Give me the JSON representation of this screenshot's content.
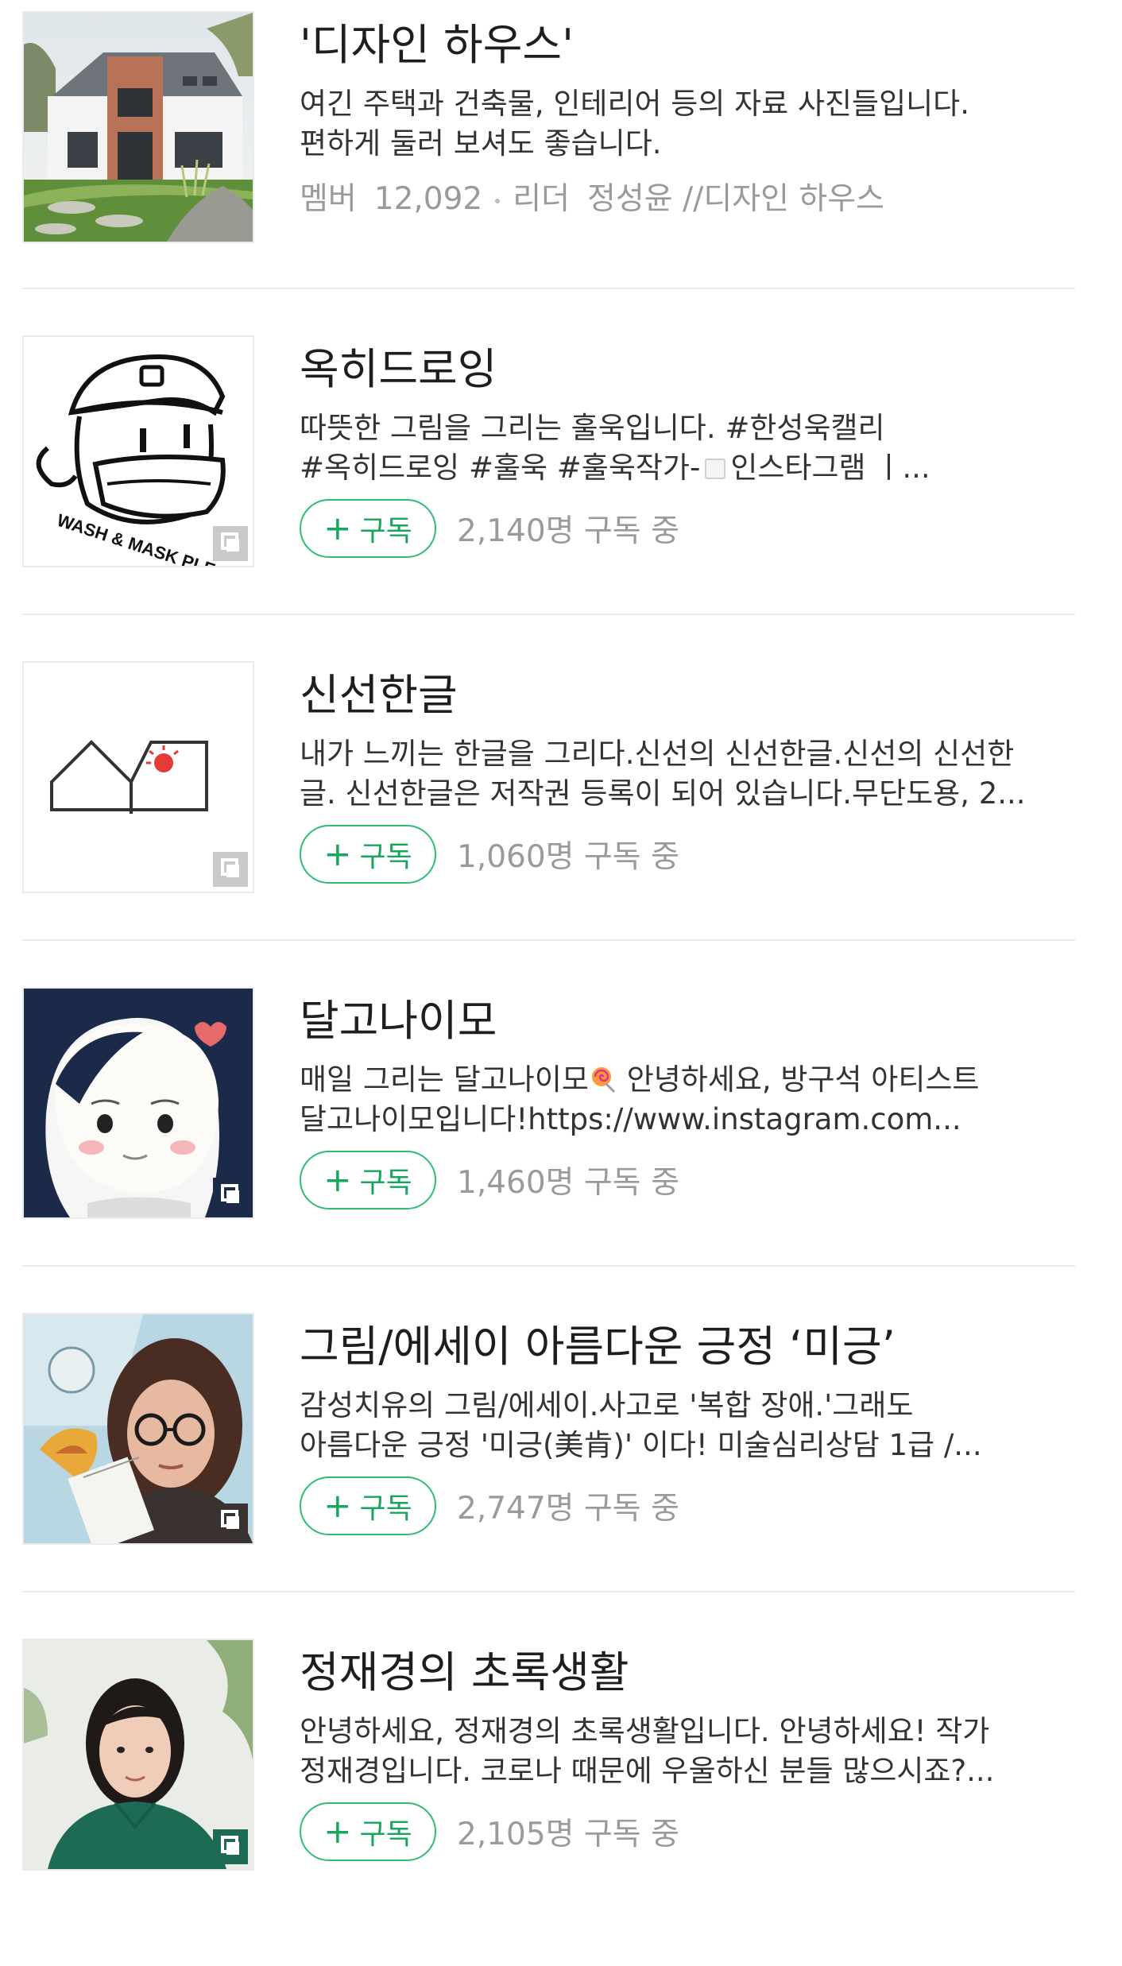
{
  "colors": {
    "accent": "#2ebd72",
    "meta_text": "#9a9a9a",
    "divider": "#ececec"
  },
  "items": [
    {
      "title": "'디자인 하우스'",
      "desc1": "여긴 주택과 건축물, 인테리어 등의 자료 사진들입니다.",
      "desc2": "편하게 둘러 보셔도 좋습니다.",
      "member_label": "멤버",
      "member_count": "12,092",
      "leader_label": "리더",
      "leader_name": "정성윤 //디자인 하우스",
      "thumb_icon": "house-photo"
    },
    {
      "title": "옥히드로잉",
      "desc1": "따뜻한 그림을 그리는 훌욱입니다. #한성욱캘리",
      "desc2a": "#옥히드로잉 #훌욱 #훌욱작가-",
      "desc2b": "인스타그램 ㅣ...",
      "subscribe_label": "구독",
      "subscriber_text": "2,140명 구독 중",
      "thumb_text": "WASH & MASK PLEASE",
      "thumb_icon": "mask-cartoon"
    },
    {
      "title": "신선한글",
      "desc1": "내가 느끼는 한글을 그리다.신선의 신선한글.신선의 신선한",
      "desc2": "글. 신선한글은 저작권 등록이 되어 있습니다.무단도용, 2...",
      "subscribe_label": "구독",
      "subscriber_text": "1,060명 구독 중",
      "thumb_icon": "hangul-roof-sun"
    },
    {
      "title": "달고나이모",
      "desc1a": "매일 그리는 달고나이모",
      "desc1b": " 안녕하세요, 방구석 아티스트",
      "desc2": "달고나이모입니다!https://www.instagram.com...",
      "subscribe_label": "구독",
      "subscriber_text": "1,460명 구독 중",
      "thumb_icon": "girl-illustration"
    },
    {
      "title": "그림/에세이 아름다운 긍정 ‘미긍’",
      "desc1": "감성치유의 그림/에세이.사고로 '복합 장애.'그래도",
      "desc2": "아름다운 긍정 '미긍(美肯)' 이다! 미술심리상담 1급 /...",
      "subscribe_label": "구독",
      "subscriber_text": "2,747명 구독 중",
      "thumb_icon": "woman-with-glasses-photo"
    },
    {
      "title": "정재경의 초록생활",
      "desc1": "안녕하세요, 정재경의 초록생활입니다. 안녕하세요! 작가",
      "desc2": "정재경입니다. 코로나 때문에 우울하신 분들 많으시죠?...",
      "subscribe_label": "구독",
      "subscriber_text": "2,105명 구독 중",
      "thumb_icon": "woman-green-shirt-photo"
    }
  ]
}
